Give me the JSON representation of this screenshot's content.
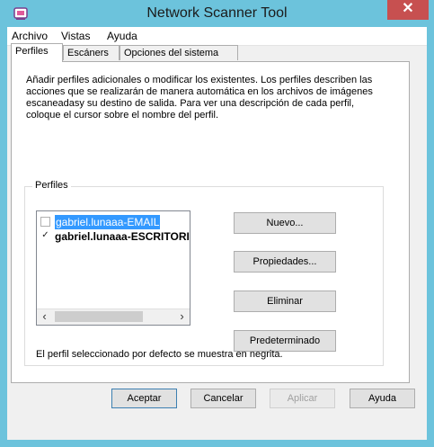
{
  "window": {
    "title": "Network Scanner Tool",
    "close_label": "✕",
    "colors": {
      "frame": "#6cc3dc",
      "close": "#c75050",
      "selection": "#3399ff"
    }
  },
  "menu": [
    {
      "label": "Archivo",
      "mnemonic_index": 1
    },
    {
      "label": "Vistas",
      "mnemonic_index": 0
    },
    {
      "label": "Ayuda",
      "mnemonic_index": 1
    }
  ],
  "tabs": [
    {
      "label": "Perfiles",
      "active": true
    },
    {
      "label": "Escáners",
      "active": false
    },
    {
      "label": "Opciones del sistema",
      "active": false
    }
  ],
  "panel": {
    "description": "Añadir perfiles adicionales o modificar los  existentes. Los perfiles describen las acciones  que se realizarán de manera automática en los archivos de imágenes escaneadasy su destino de salida. Para ver una descripción de cada perfil, coloque el cursor sobre el nombre del perfil.",
    "group_label": "Perfiles",
    "profiles": [
      {
        "name": "gabriel.lunaaa-EMAIL",
        "checked": false,
        "selected": true,
        "default": false
      },
      {
        "name": "gabriel.lunaaa-ESCRITORIO",
        "checked": true,
        "selected": false,
        "default": true
      }
    ],
    "buttons": {
      "new": "Nuevo...",
      "properties": "Propiedades...",
      "delete": "Eliminar",
      "default": "Predeterminado"
    },
    "note": "El perfil seleccionado por defecto se muestra en  negrita."
  },
  "footer": {
    "accept": "Aceptar",
    "cancel": "Cancelar",
    "apply": "Aplicar",
    "help": "Ayuda"
  }
}
